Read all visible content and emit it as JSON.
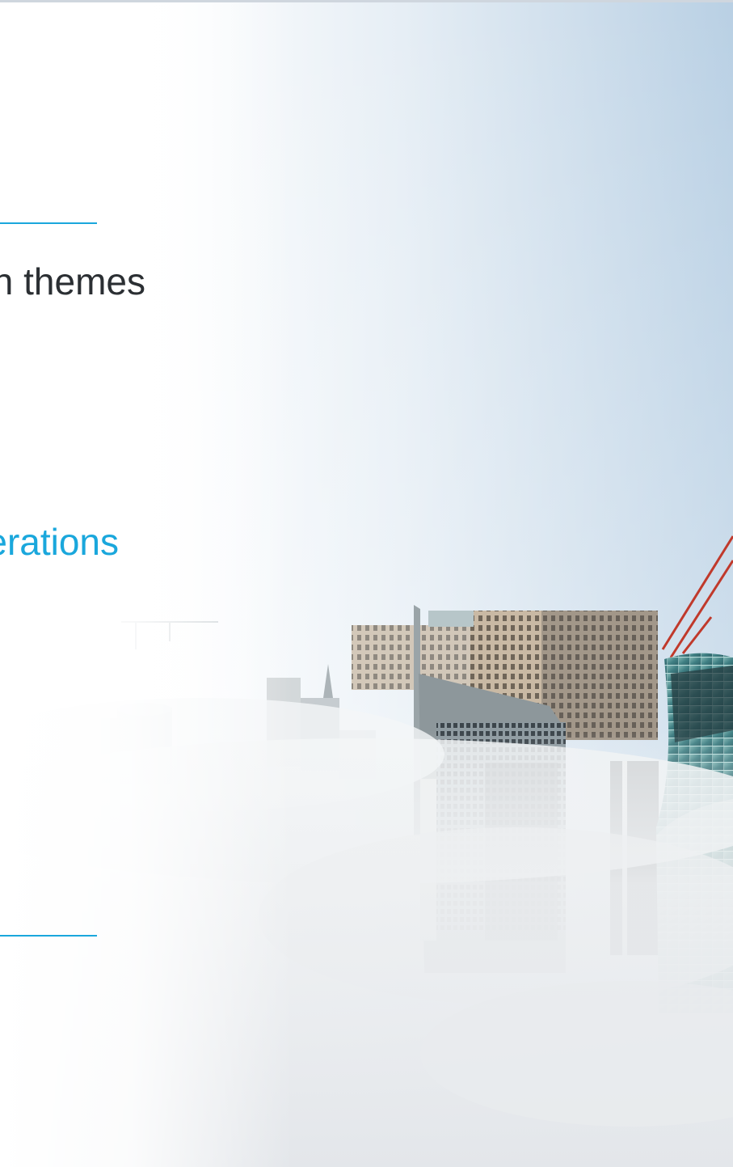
{
  "slide": {
    "heading": "In themes",
    "subheading": "Operations"
  },
  "colors": {
    "accent": "#1aa7dc",
    "text": "#2b2f33"
  }
}
